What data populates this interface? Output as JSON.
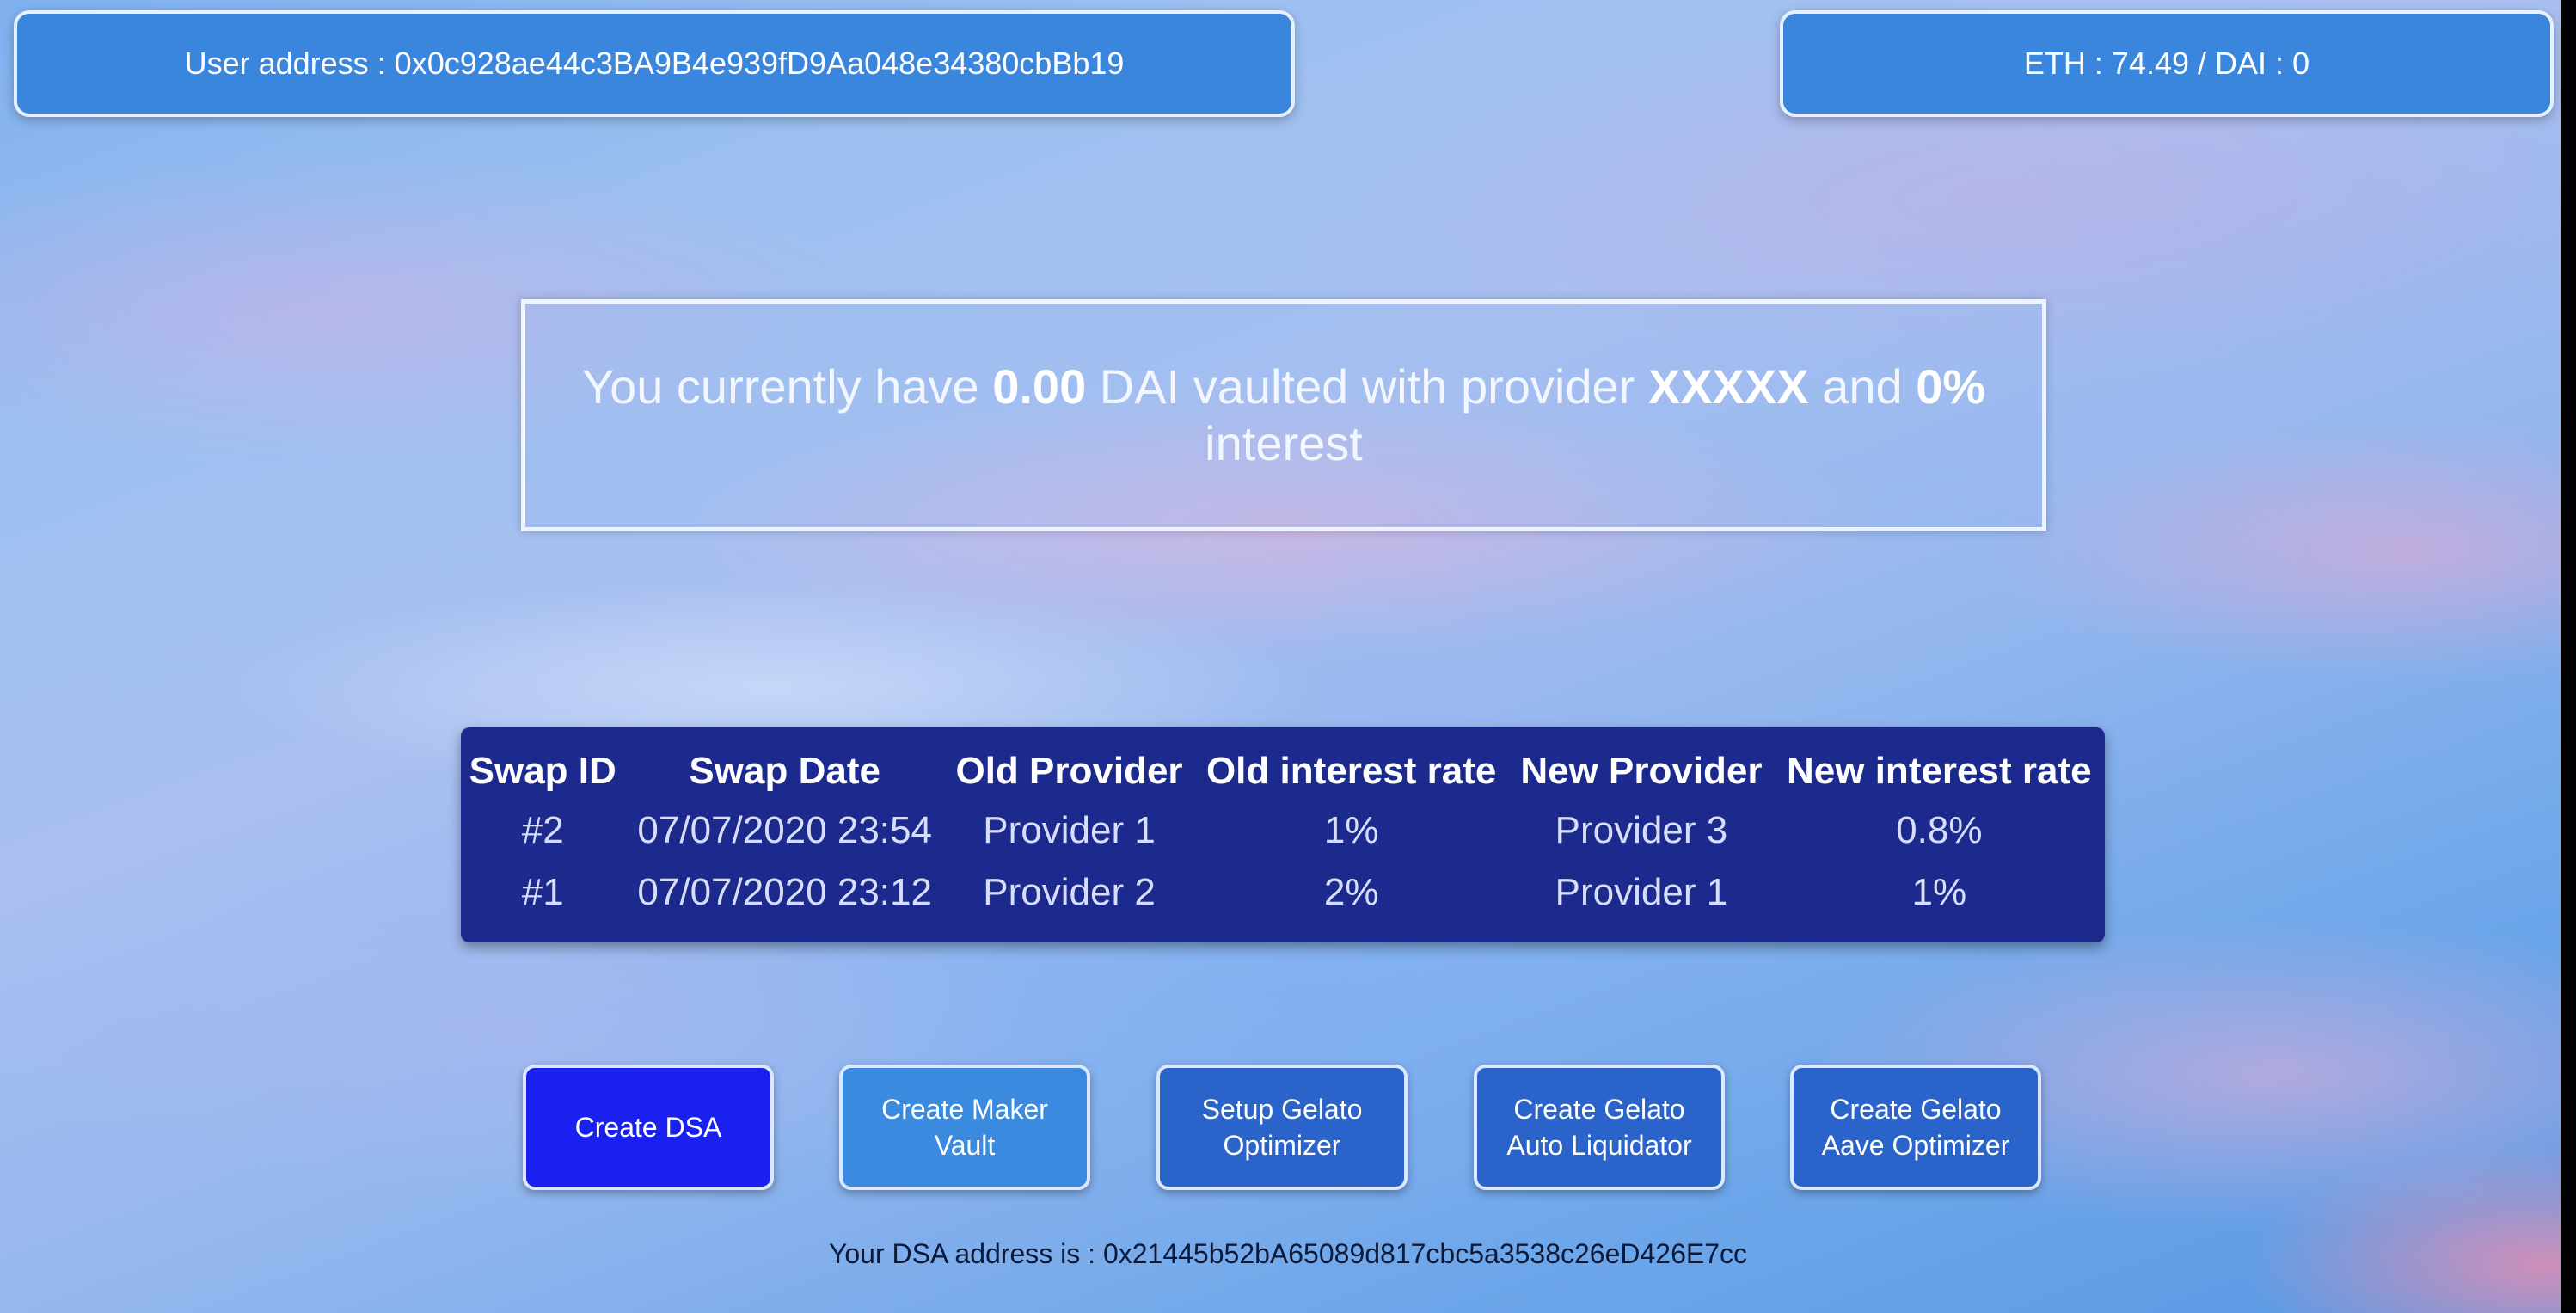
{
  "header": {
    "user_address": "User address : 0x0c928ae44c3BA9B4e939fD9Aa048e34380cbBb19",
    "balance": "ETH : 74.49 / DAI : 0"
  },
  "vault": {
    "prefix": "You currently have",
    "amount": "0.00",
    "middle": "DAI vaulted with provider",
    "provider": "XXXXX",
    "conjunction": "and",
    "interest": "0%",
    "suffix": "interest"
  },
  "swaps": {
    "headers": [
      "Swap ID",
      "Swap Date",
      "Old Provider",
      "Old interest rate",
      "New Provider",
      "New interest rate"
    ],
    "rows": [
      [
        "#2",
        "07/07/2020 23:54",
        "Provider 1",
        "1%",
        "Provider 3",
        "0.8%"
      ],
      [
        "#1",
        "07/07/2020 23:12",
        "Provider 2",
        "2%",
        "Provider 1",
        "1%"
      ]
    ]
  },
  "actions": {
    "create_dsa": "Create DSA",
    "create_maker_vault": [
      "Create Maker",
      "Vault"
    ],
    "setup_gelato_optimizer": [
      "Setup Gelato",
      "Optimizer"
    ],
    "create_gelato_auto_liquidator": [
      "Create Gelato",
      "Auto Liquidator"
    ],
    "create_gelato_aave_optimizer": [
      "Create Gelato",
      "Aave Optimizer"
    ]
  },
  "footer": {
    "dsa_address": "Your DSA address is : 0x21445b52bA65089d817cbc5a3538c26eD426E7cc"
  },
  "colors": {
    "create_dsa": "#1a20f0",
    "table_bg": "#1d2a8d",
    "top_bar": "#3a86dc"
  }
}
